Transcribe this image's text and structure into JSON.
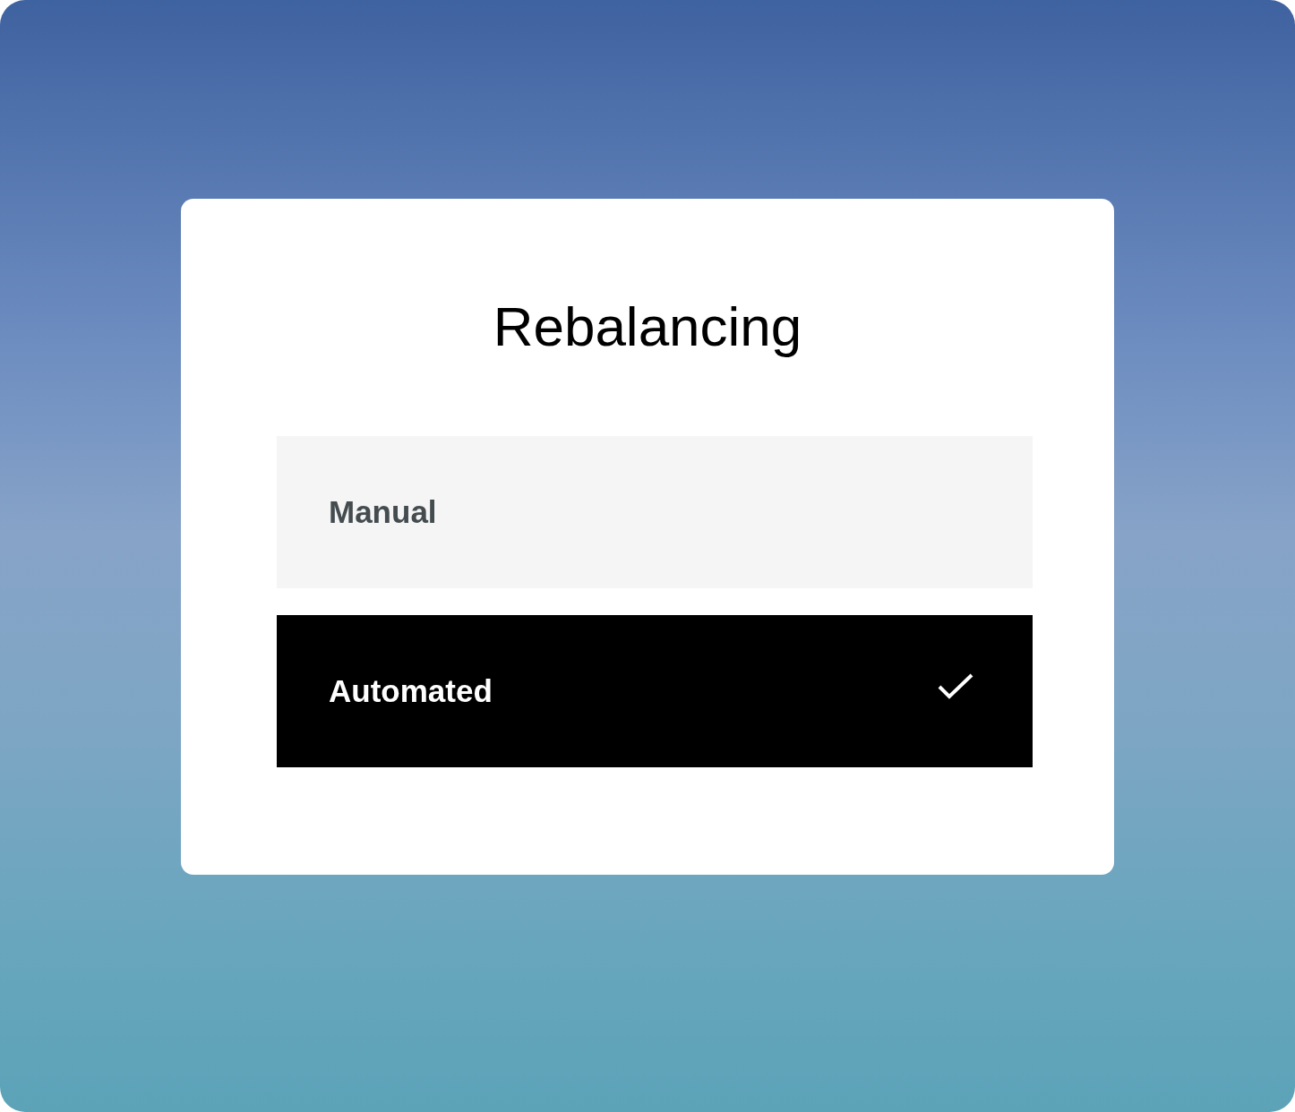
{
  "title": "Rebalancing",
  "options": [
    {
      "label": "Manual",
      "selected": false
    },
    {
      "label": "Automated",
      "selected": true
    }
  ]
}
